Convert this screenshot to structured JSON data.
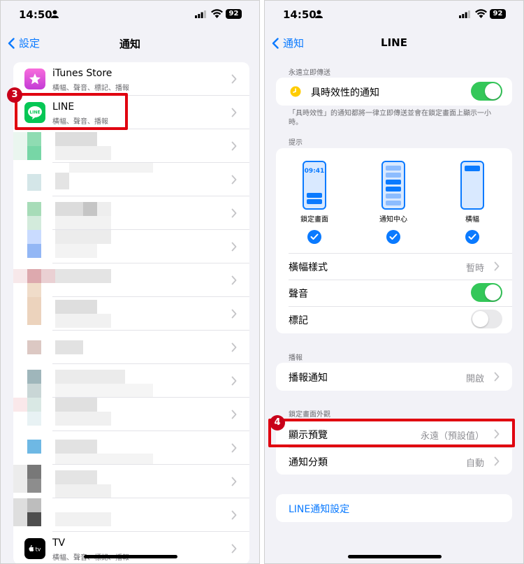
{
  "status_bar": {
    "time": "14:50",
    "battery": "92"
  },
  "left": {
    "back_label": "設定",
    "title": "通知",
    "apps": [
      {
        "name": "iTunes Store",
        "sub": "橫幅、聲音、標記、播報"
      },
      {
        "name": "LINE",
        "sub": "橫幅、聲音、播報"
      },
      {
        "name": "TV",
        "sub": "橫幅、聲音、標記、播報"
      }
    ],
    "badge": "3",
    "icons": {
      "itunes": "star-icon",
      "line": "line-logo-icon",
      "tv": "apple-tv-icon"
    }
  },
  "right": {
    "back_label": "通知",
    "title": "LINE",
    "time_sensitive_header": "永遠立即傳送",
    "time_sensitive_label": "具時效性的通知",
    "time_sensitive_note": "「具時效性」的通知都將一律立即傳送並會在鎖定畫面上顯示一小時。",
    "alerts_header": "提示",
    "lock_screen_time": "09:41",
    "alert_styles": [
      "鎖定畫面",
      "通知中心",
      "橫幅"
    ],
    "banner_style_label": "橫幅樣式",
    "banner_style_value": "暫時",
    "sounds_label": "聲音",
    "badges_label": "標記",
    "announce_header": "播報",
    "announce_label": "播報通知",
    "announce_value": "開啟",
    "lock_appearance_header": "鎖定畫面外觀",
    "show_previews_label": "顯示預覽",
    "show_previews_value": "永遠（預設值）",
    "grouping_label": "通知分類",
    "grouping_value": "自動",
    "line_settings_link": "LINE通知設定",
    "badge": "4",
    "toggles": {
      "time_sensitive": true,
      "sounds": true,
      "badges": false
    }
  },
  "colors": {
    "accent": "#0a7aff",
    "toggle_on": "#34c759",
    "highlight": "#e0000f",
    "line_green": "#06c755"
  }
}
